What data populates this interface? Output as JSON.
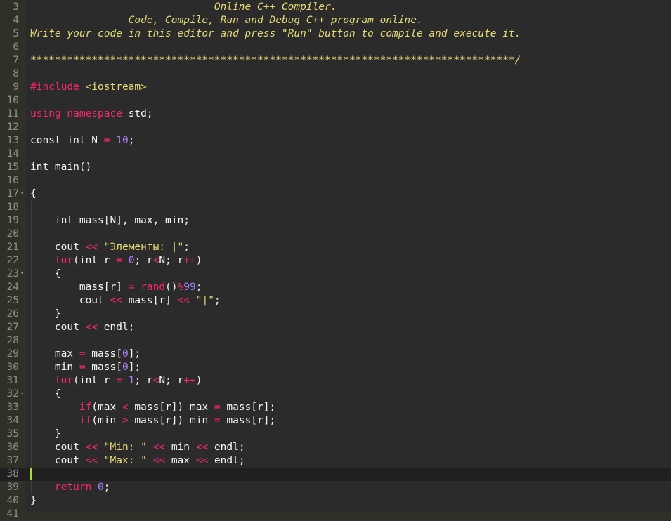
{
  "editor": {
    "lines": [
      {
        "n": "3",
        "tokens": [
          {
            "t": "                              Online C++ Compiler.",
            "c": "cm"
          }
        ]
      },
      {
        "n": "4",
        "tokens": [
          {
            "t": "                Code, Compile, Run and Debug C++ program online.",
            "c": "cm"
          }
        ]
      },
      {
        "n": "5",
        "tokens": [
          {
            "t": "Write your code in this editor and press \"Run\" button to compile and execute it.",
            "c": "cm"
          }
        ]
      },
      {
        "n": "6",
        "tokens": []
      },
      {
        "n": "7",
        "tokens": [
          {
            "t": "*******************************************************************************/",
            "c": "cm"
          }
        ]
      },
      {
        "n": "8",
        "tokens": []
      },
      {
        "n": "9",
        "tokens": [
          {
            "t": "#include ",
            "c": "pp"
          },
          {
            "t": "<iostream>",
            "c": "inc"
          }
        ]
      },
      {
        "n": "10",
        "tokens": []
      },
      {
        "n": "11",
        "tokens": [
          {
            "t": "using ",
            "c": "kw"
          },
          {
            "t": "namespace ",
            "c": "kw"
          },
          {
            "t": "std;",
            "c": "pl"
          }
        ]
      },
      {
        "n": "12",
        "tokens": []
      },
      {
        "n": "13",
        "tokens": [
          {
            "t": "const int N ",
            "c": "pl"
          },
          {
            "t": "=",
            "c": "op"
          },
          {
            "t": " ",
            "c": "pl"
          },
          {
            "t": "10",
            "c": "num"
          },
          {
            "t": ";",
            "c": "pl"
          }
        ]
      },
      {
        "n": "14",
        "tokens": []
      },
      {
        "n": "15",
        "tokens": [
          {
            "t": "int main()",
            "c": "pl"
          }
        ]
      },
      {
        "n": "16",
        "tokens": []
      },
      {
        "n": "17",
        "fold": true,
        "tokens": [
          {
            "t": "{",
            "c": "pl"
          }
        ]
      },
      {
        "n": "18",
        "tokens": []
      },
      {
        "n": "19",
        "tokens": [
          {
            "t": "    int mass[N], max, min;",
            "c": "pl"
          }
        ]
      },
      {
        "n": "20",
        "tokens": []
      },
      {
        "n": "21",
        "tokens": [
          {
            "t": "    cout ",
            "c": "pl"
          },
          {
            "t": "<<",
            "c": "op"
          },
          {
            "t": " ",
            "c": "pl"
          },
          {
            "t": "\"Элементы: |\"",
            "c": "str"
          },
          {
            "t": ";",
            "c": "pl"
          }
        ]
      },
      {
        "n": "22",
        "tokens": [
          {
            "t": "    ",
            "c": "pl"
          },
          {
            "t": "for",
            "c": "kw"
          },
          {
            "t": "(int r ",
            "c": "pl"
          },
          {
            "t": "=",
            "c": "op"
          },
          {
            "t": " ",
            "c": "pl"
          },
          {
            "t": "0",
            "c": "num"
          },
          {
            "t": "; r",
            "c": "pl"
          },
          {
            "t": "<",
            "c": "op"
          },
          {
            "t": "N; r",
            "c": "pl"
          },
          {
            "t": "++",
            "c": "op"
          },
          {
            "t": ")",
            "c": "pl"
          }
        ]
      },
      {
        "n": "23",
        "fold": true,
        "tokens": [
          {
            "t": "    {",
            "c": "pl"
          }
        ]
      },
      {
        "n": "24",
        "tokens": [
          {
            "t": "        mass[r] ",
            "c": "pl"
          },
          {
            "t": "=",
            "c": "op"
          },
          {
            "t": " ",
            "c": "pl"
          },
          {
            "t": "rand",
            "c": "rand"
          },
          {
            "t": "()",
            "c": "pl"
          },
          {
            "t": "%",
            "c": "op"
          },
          {
            "t": "99",
            "c": "num"
          },
          {
            "t": ";",
            "c": "pl"
          }
        ]
      },
      {
        "n": "25",
        "tokens": [
          {
            "t": "        cout ",
            "c": "pl"
          },
          {
            "t": "<<",
            "c": "op"
          },
          {
            "t": " mass[r] ",
            "c": "pl"
          },
          {
            "t": "<<",
            "c": "op"
          },
          {
            "t": " ",
            "c": "pl"
          },
          {
            "t": "\"|\"",
            "c": "str"
          },
          {
            "t": ";",
            "c": "pl"
          }
        ]
      },
      {
        "n": "26",
        "tokens": [
          {
            "t": "    }",
            "c": "pl"
          }
        ]
      },
      {
        "n": "27",
        "tokens": [
          {
            "t": "    cout ",
            "c": "pl"
          },
          {
            "t": "<<",
            "c": "op"
          },
          {
            "t": " endl;",
            "c": "pl"
          }
        ]
      },
      {
        "n": "28",
        "tokens": []
      },
      {
        "n": "29",
        "tokens": [
          {
            "t": "    max ",
            "c": "pl"
          },
          {
            "t": "=",
            "c": "op"
          },
          {
            "t": " mass[",
            "c": "pl"
          },
          {
            "t": "0",
            "c": "num"
          },
          {
            "t": "];",
            "c": "pl"
          }
        ]
      },
      {
        "n": "30",
        "tokens": [
          {
            "t": "    min ",
            "c": "pl"
          },
          {
            "t": "=",
            "c": "op"
          },
          {
            "t": " mass[",
            "c": "pl"
          },
          {
            "t": "0",
            "c": "num"
          },
          {
            "t": "];",
            "c": "pl"
          }
        ]
      },
      {
        "n": "31",
        "tokens": [
          {
            "t": "    ",
            "c": "pl"
          },
          {
            "t": "for",
            "c": "kw"
          },
          {
            "t": "(int r ",
            "c": "pl"
          },
          {
            "t": "=",
            "c": "op"
          },
          {
            "t": " ",
            "c": "pl"
          },
          {
            "t": "1",
            "c": "num"
          },
          {
            "t": "; r",
            "c": "pl"
          },
          {
            "t": "<",
            "c": "op"
          },
          {
            "t": "N; r",
            "c": "pl"
          },
          {
            "t": "++",
            "c": "op"
          },
          {
            "t": ")",
            "c": "pl"
          }
        ]
      },
      {
        "n": "32",
        "fold": true,
        "tokens": [
          {
            "t": "    {",
            "c": "pl"
          }
        ]
      },
      {
        "n": "33",
        "tokens": [
          {
            "t": "        ",
            "c": "pl"
          },
          {
            "t": "if",
            "c": "kw"
          },
          {
            "t": "(max ",
            "c": "pl"
          },
          {
            "t": "<",
            "c": "op"
          },
          {
            "t": " mass[r]) max ",
            "c": "pl"
          },
          {
            "t": "=",
            "c": "op"
          },
          {
            "t": " mass[r];",
            "c": "pl"
          }
        ]
      },
      {
        "n": "34",
        "tokens": [
          {
            "t": "        ",
            "c": "pl"
          },
          {
            "t": "if",
            "c": "kw"
          },
          {
            "t": "(min ",
            "c": "pl"
          },
          {
            "t": ">",
            "c": "op"
          },
          {
            "t": " mass[r]) min ",
            "c": "pl"
          },
          {
            "t": "=",
            "c": "op"
          },
          {
            "t": " mass[r];",
            "c": "pl"
          }
        ]
      },
      {
        "n": "35",
        "tokens": [
          {
            "t": "    }",
            "c": "pl"
          }
        ]
      },
      {
        "n": "36",
        "tokens": [
          {
            "t": "    cout ",
            "c": "pl"
          },
          {
            "t": "<<",
            "c": "op"
          },
          {
            "t": " ",
            "c": "pl"
          },
          {
            "t": "\"Min: \"",
            "c": "str"
          },
          {
            "t": " ",
            "c": "pl"
          },
          {
            "t": "<<",
            "c": "op"
          },
          {
            "t": " min ",
            "c": "pl"
          },
          {
            "t": "<<",
            "c": "op"
          },
          {
            "t": " endl;",
            "c": "pl"
          }
        ]
      },
      {
        "n": "37",
        "tokens": [
          {
            "t": "    cout ",
            "c": "pl"
          },
          {
            "t": "<<",
            "c": "op"
          },
          {
            "t": " ",
            "c": "pl"
          },
          {
            "t": "\"Max: \"",
            "c": "str"
          },
          {
            "t": " ",
            "c": "pl"
          },
          {
            "t": "<<",
            "c": "op"
          },
          {
            "t": " max ",
            "c": "pl"
          },
          {
            "t": "<<",
            "c": "op"
          },
          {
            "t": " endl;",
            "c": "pl"
          }
        ]
      },
      {
        "n": "38",
        "active": true,
        "cursor": true,
        "tokens": []
      },
      {
        "n": "39",
        "tokens": [
          {
            "t": "    ",
            "c": "pl"
          },
          {
            "t": "return",
            "c": "kw"
          },
          {
            "t": " ",
            "c": "pl"
          },
          {
            "t": "0",
            "c": "num"
          },
          {
            "t": ";",
            "c": "pl"
          }
        ]
      },
      {
        "n": "40",
        "tokens": [
          {
            "t": "}",
            "c": "pl"
          }
        ]
      },
      {
        "n": "41",
        "tokens": []
      }
    ]
  },
  "colors": {
    "background": "#2b2b2b",
    "gutter": "#2f3129",
    "active_line": "#202020",
    "comment": "#e6db74",
    "keyword": "#f92672",
    "string": "#e6db74",
    "number": "#ae81ff",
    "text": "#f8f8f2",
    "line_number": "#8f908a",
    "cursor": "#a6e22e"
  },
  "icons": {
    "fold": "fold-arrow-icon"
  }
}
